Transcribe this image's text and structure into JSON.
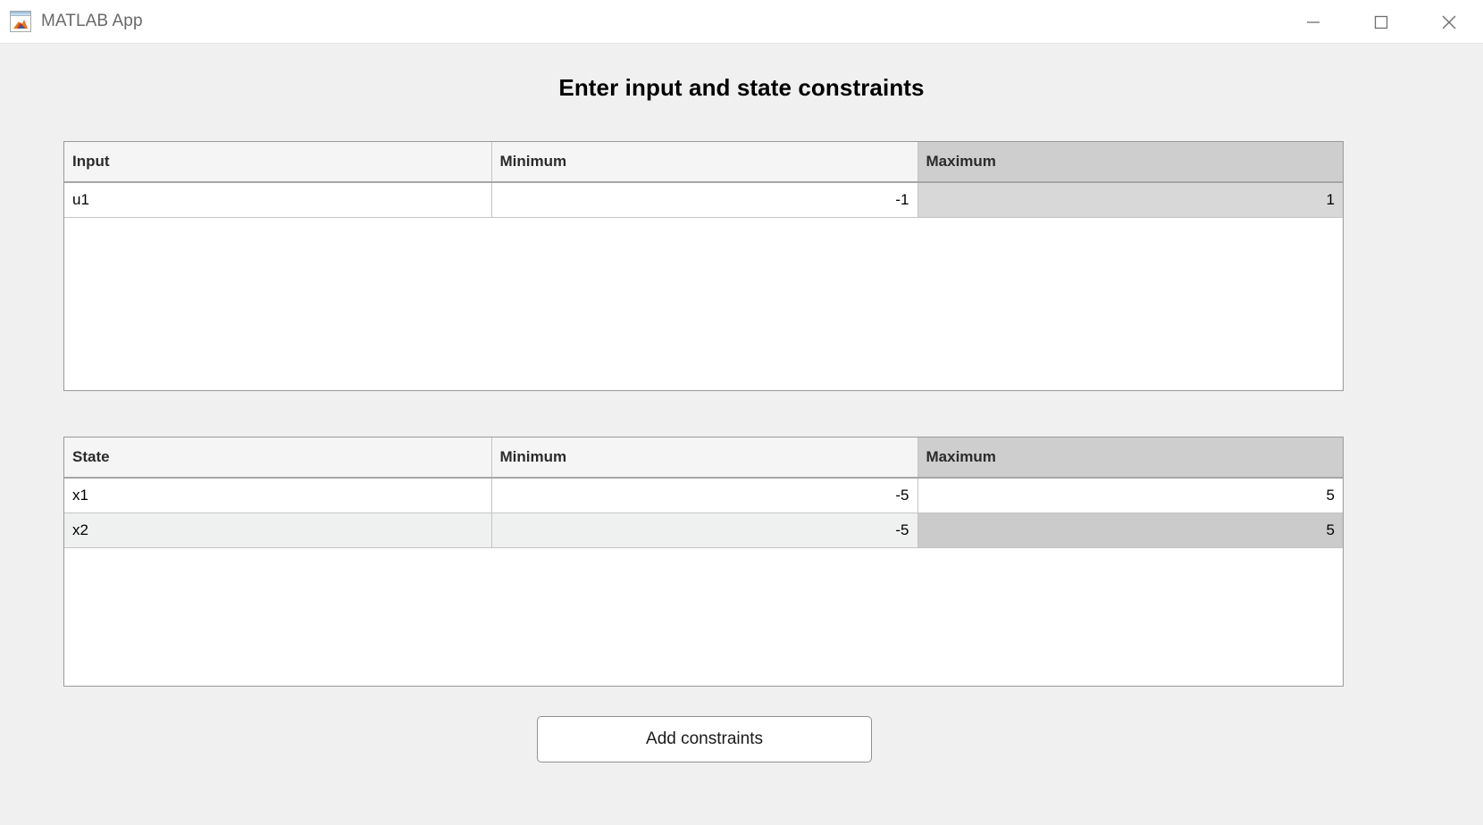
{
  "window": {
    "title": "MATLAB App",
    "icon": "matlab-app-icon",
    "controls": {
      "minimize": "minimize-icon",
      "maximize": "maximize-icon",
      "close": "close-icon"
    }
  },
  "page": {
    "heading": "Enter input and state constraints"
  },
  "input_table": {
    "columns": [
      "Input",
      "Minimum",
      "Maximum"
    ],
    "selected_column": "Maximum",
    "rows": [
      {
        "name": "u1",
        "minimum": "-1",
        "maximum": "1"
      }
    ]
  },
  "state_table": {
    "columns": [
      "State",
      "Minimum",
      "Maximum"
    ],
    "selected_column": "Maximum",
    "rows": [
      {
        "name": "x1",
        "minimum": "-5",
        "maximum": "5"
      },
      {
        "name": "x2",
        "minimum": "-5",
        "maximum": "5"
      }
    ]
  },
  "actions": {
    "add_constraints_label": "Add constraints"
  },
  "colors": {
    "page_background": "#f0f0f0",
    "titlebar_background": "#ffffff",
    "header_background": "#f5f5f5",
    "header_selected_background": "#cecece",
    "cell_selected_background": "#d8d8d8",
    "row_alt_background": "#eff0f0",
    "table_border": "#9a9a9a"
  }
}
